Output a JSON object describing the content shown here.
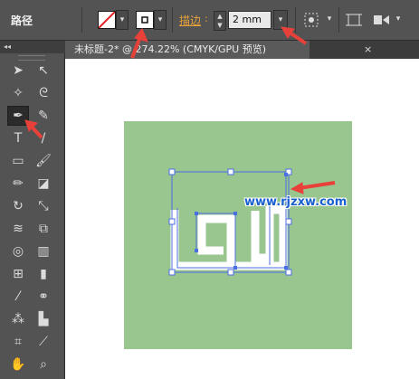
{
  "control_bar": {
    "mode_label": "路径",
    "stroke_label": "描边",
    "stroke_colon": ":",
    "stroke_value": "2 mm"
  },
  "document_tab": {
    "title": "未标题-2* @ 274.22% (CMYK/GPU 预览)",
    "close_glyph": "×"
  },
  "toolbox": {
    "collapse_glyph": "◂◂",
    "tools": [
      {
        "name": "selection-tool",
        "glyph": "➤"
      },
      {
        "name": "direct-selection-tool",
        "glyph": "↖"
      },
      {
        "name": "magic-wand-tool",
        "glyph": "✧"
      },
      {
        "name": "lasso-tool",
        "glyph": "ᘓ"
      },
      {
        "name": "pen-tool",
        "glyph": "✒"
      },
      {
        "name": "curvature-tool",
        "glyph": "✎"
      },
      {
        "name": "type-tool",
        "glyph": "T"
      },
      {
        "name": "line-segment-tool",
        "glyph": "/"
      },
      {
        "name": "rectangle-tool",
        "glyph": "▭"
      },
      {
        "name": "paintbrush-tool",
        "glyph": "🖌"
      },
      {
        "name": "pencil-tool",
        "glyph": "✏"
      },
      {
        "name": "eraser-tool",
        "glyph": "◪"
      },
      {
        "name": "rotate-tool",
        "glyph": "↻"
      },
      {
        "name": "scale-tool",
        "glyph": "⤡"
      },
      {
        "name": "warp-tool",
        "glyph": "≋"
      },
      {
        "name": "free-transform-tool",
        "glyph": "⧉"
      },
      {
        "name": "shape-builder-tool",
        "glyph": "◎"
      },
      {
        "name": "chart-tool",
        "glyph": "▥"
      },
      {
        "name": "mesh-tool",
        "glyph": "⊞"
      },
      {
        "name": "gradient-tool",
        "glyph": "▮"
      },
      {
        "name": "eyedropper-tool",
        "glyph": "⁄"
      },
      {
        "name": "blend-tool",
        "glyph": "⚭"
      },
      {
        "name": "symbol-sprayer-tool",
        "glyph": "⁂"
      },
      {
        "name": "column-graph-tool",
        "glyph": "▙"
      },
      {
        "name": "artboard-tool",
        "glyph": "⌗"
      },
      {
        "name": "slice-tool",
        "glyph": "⟋"
      },
      {
        "name": "hand-tool",
        "glyph": "✋"
      },
      {
        "name": "zoom-tool",
        "glyph": "⌕"
      }
    ]
  },
  "watermark": "www.rjzxw.com",
  "colors": {
    "artboard_green": "#99c68e",
    "selection_blue": "#4a6fe3",
    "arrow_red": "#e8413a",
    "stroke_label_orange": "#e8a23a",
    "watermark_blue": "#1a5fd0"
  }
}
